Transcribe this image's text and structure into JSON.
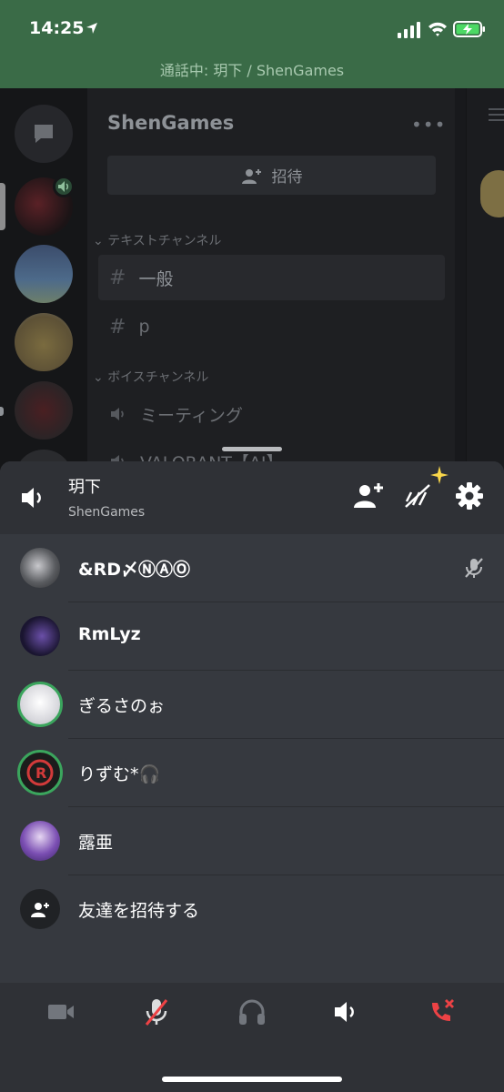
{
  "status_bar": {
    "time": "14:25",
    "call_banner": "通話中: 玥下 / ShenGames"
  },
  "background": {
    "server_name": "ShenGames",
    "more": "•••",
    "invite_label": "招待",
    "text_category": "テキストチャンネル",
    "text_channels": [
      {
        "name": "一般",
        "selected": true
      },
      {
        "name": "p",
        "selected": false
      }
    ],
    "voice_category": "ボイスチャンネル",
    "voice_channels": [
      {
        "name": "ミーティング"
      },
      {
        "name": "VALORANT【AI】"
      }
    ]
  },
  "voice_sheet": {
    "channel_name": "玥下",
    "server_name": "ShenGames",
    "members": [
      {
        "name": "&RD〆ⓃⒶⓄ",
        "bold": true,
        "speaking": false,
        "muted": true,
        "avatar_color": "#5a5c60"
      },
      {
        "name": "RmLyz",
        "bold": true,
        "speaking": false,
        "muted": false,
        "avatar_color": "#1a1530"
      },
      {
        "name": "ぎるさのぉ",
        "bold": false,
        "speaking": true,
        "muted": false,
        "avatar_color": "#e8e8ea"
      },
      {
        "name": "りずむ*🎧",
        "bold": false,
        "speaking": true,
        "muted": false,
        "avatar_color": "#1c1c1c"
      },
      {
        "name": "露亜",
        "bold": false,
        "speaking": false,
        "muted": false,
        "avatar_color": "#5b3a8c"
      }
    ],
    "invite_friends": "友達を招待する"
  },
  "colors": {
    "status_green": "#3a6b47",
    "speaking_ring": "#3ba55d",
    "hangup_red": "#ed4245"
  },
  "icons": {
    "controls": [
      "video-camera-icon",
      "microphone-muted-icon",
      "headphones-icon",
      "speaker-icon",
      "hang-up-icon"
    ]
  }
}
